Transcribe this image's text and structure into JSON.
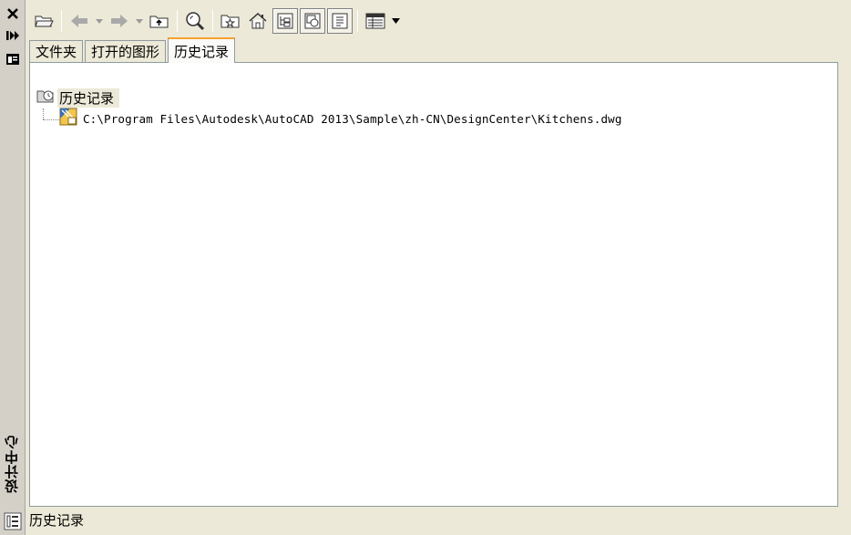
{
  "side_panel": {
    "title": "设计中心",
    "close_icon": "close-icon",
    "autohide_icon": "autohide-icon",
    "properties_icon": "properties-icon"
  },
  "toolbar": {
    "buttons": [
      "load-icon",
      "back-icon",
      "forward-icon",
      "up-icon",
      "search-icon",
      "favorites-icon",
      "home-icon",
      "tree-view-toggle-icon",
      "preview-icon",
      "description-icon",
      "views-icon"
    ]
  },
  "tabs": [
    {
      "label": "文件夹",
      "active": false
    },
    {
      "label": "打开的图形",
      "active": false
    },
    {
      "label": "历史记录",
      "active": true
    }
  ],
  "tree": {
    "root_label": "历史记录",
    "items": [
      {
        "path": "C:\\Program Files\\Autodesk\\AutoCAD 2013\\Sample\\zh-CN\\DesignCenter\\Kitchens.dwg"
      }
    ]
  },
  "status": {
    "text": "历史记录"
  },
  "colors": {
    "background": "#ece9d8",
    "content_bg": "#ffffff",
    "active_tab_accent": "#f6a22f"
  }
}
